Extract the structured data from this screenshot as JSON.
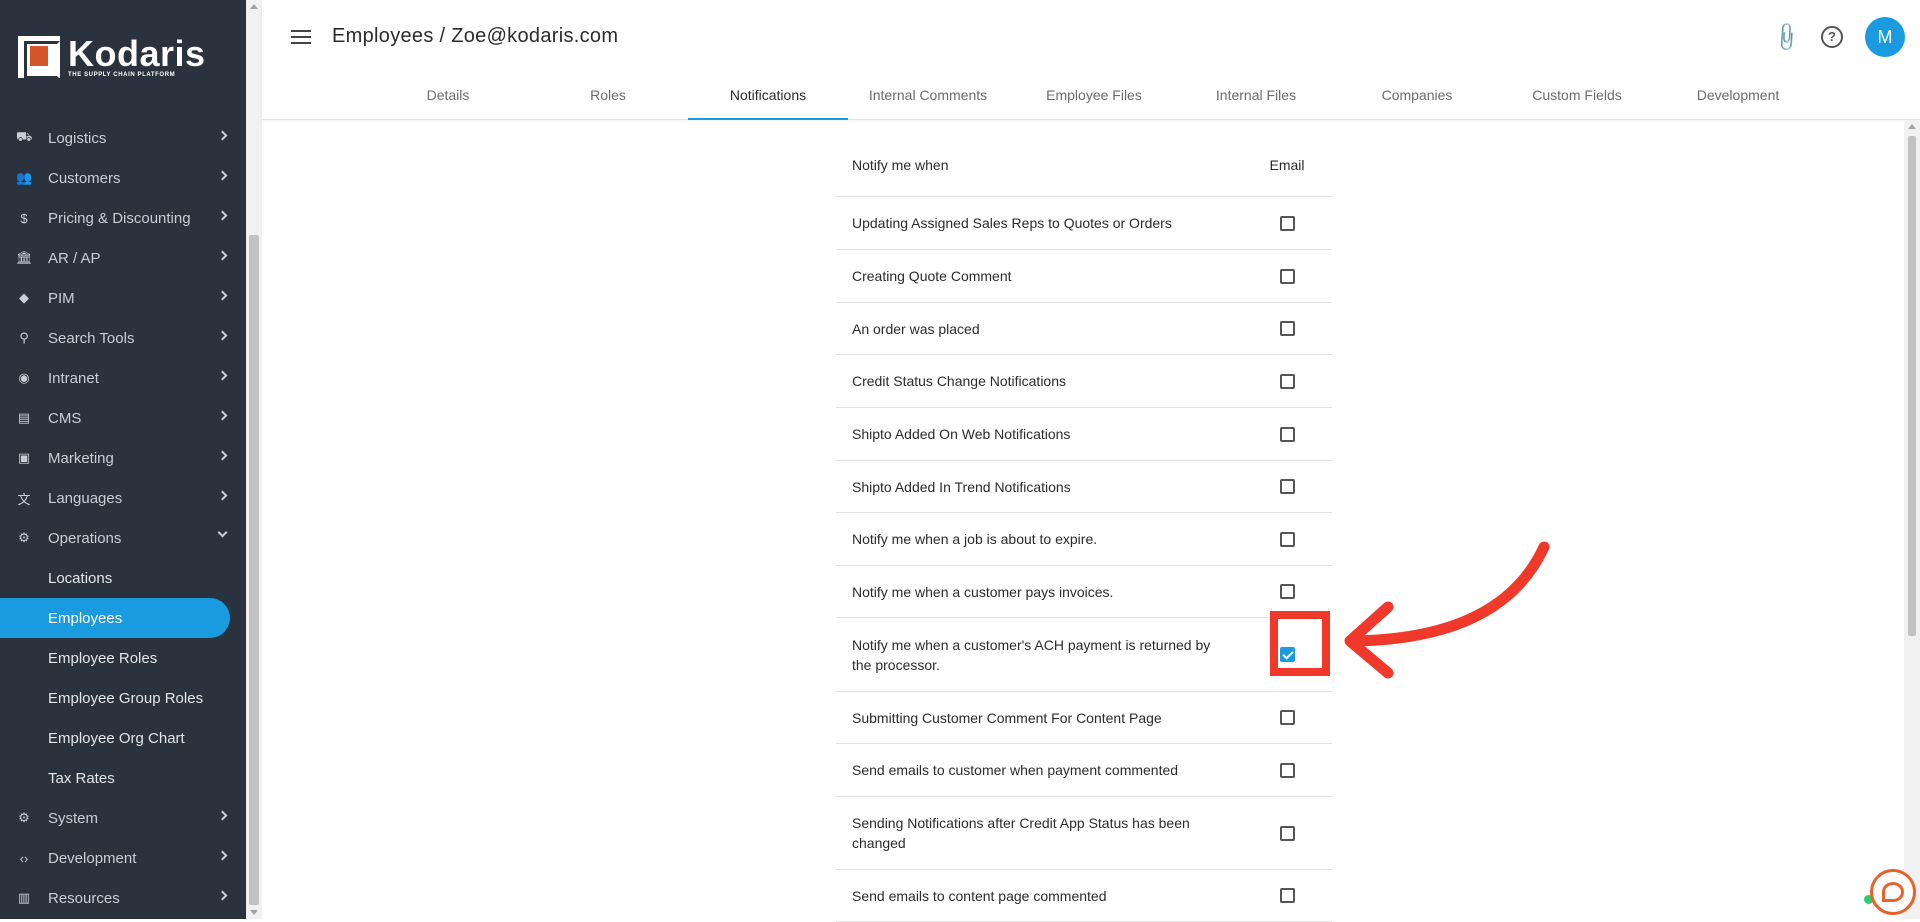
{
  "brand": {
    "name": "Kodaris",
    "tagline": "THE SUPPLY CHAIN PLATFORM"
  },
  "sidebar": {
    "items": [
      {
        "label": "Logistics",
        "icon": "truck-icon"
      },
      {
        "label": "Customers",
        "icon": "people-icon"
      },
      {
        "label": "Pricing & Discounting",
        "icon": "dollar-icon"
      },
      {
        "label": "AR / AP",
        "icon": "bank-icon"
      },
      {
        "label": "PIM",
        "icon": "tag-icon"
      },
      {
        "label": "Search Tools",
        "icon": "search-icon"
      },
      {
        "label": "Intranet",
        "icon": "globe-icon"
      },
      {
        "label": "CMS",
        "icon": "cms-icon"
      },
      {
        "label": "Marketing",
        "icon": "marketing-icon"
      },
      {
        "label": "Languages",
        "icon": "translate-icon"
      },
      {
        "label": "Operations",
        "icon": "operations-icon"
      }
    ],
    "operations_children": [
      "Locations",
      "Employees",
      "Employee Roles",
      "Employee Group Roles",
      "Employee Org Chart",
      "Tax Rates"
    ],
    "active_child": "Employees",
    "bottom_items": [
      {
        "label": "System",
        "icon": "gear-icon"
      },
      {
        "label": "Development",
        "icon": "code-icon"
      },
      {
        "label": "Resources",
        "icon": "book-icon"
      }
    ]
  },
  "header": {
    "title": "Employees / Zoe@kodaris.com",
    "avatar_initial": "M"
  },
  "tabs": [
    "Details",
    "Roles",
    "Notifications",
    "Internal Comments",
    "Employee Files",
    "Internal Files",
    "Companies",
    "Custom Fields",
    "Development"
  ],
  "active_tab": "Notifications",
  "notifications": {
    "header_event": "Notify me when",
    "header_email": "Email",
    "rows": [
      {
        "label": "Updating Assigned Sales Reps to Quotes or Orders",
        "email": false
      },
      {
        "label": "Creating Quote Comment",
        "email": false
      },
      {
        "label": "An order was placed",
        "email": false
      },
      {
        "label": "Credit Status Change Notifications",
        "email": false
      },
      {
        "label": "Shipto Added On Web Notifications",
        "email": false
      },
      {
        "label": "Shipto Added In Trend Notifications",
        "email": false
      },
      {
        "label": "Notify me when a job is about to expire.",
        "email": false
      },
      {
        "label": "Notify me when a customer pays invoices.",
        "email": false
      },
      {
        "label": "Notify me when a customer's ACH payment is returned by the processor.",
        "email": true
      },
      {
        "label": "Submitting Customer Comment For Content Page",
        "email": false
      },
      {
        "label": "Send emails to customer when payment commented",
        "email": false
      },
      {
        "label": "Sending Notifications after Credit App Status has been changed",
        "email": false
      },
      {
        "label": "Send emails to content page commented",
        "email": false
      }
    ]
  },
  "colors": {
    "sidebar_bg": "#2a323d",
    "accent": "#1a9be0",
    "annotation": "#f0392b"
  }
}
